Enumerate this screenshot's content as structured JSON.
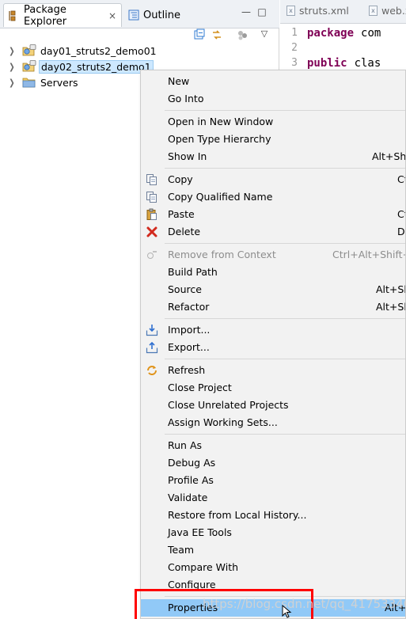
{
  "explorer": {
    "tabs": [
      {
        "label": "Package Explorer",
        "active": true
      },
      {
        "label": "Outline",
        "active": false
      }
    ],
    "close_glyph": "×",
    "minimize_glyph": "—",
    "maximize_glyph": "□",
    "view_menu_glyph": "▽",
    "tree": [
      {
        "label": "day01_struts2_demo01",
        "icon": "project-icon",
        "selected": false
      },
      {
        "label": "day02_struts2_demo1",
        "icon": "project-icon",
        "selected": true
      },
      {
        "label": "Servers",
        "icon": "folder-icon",
        "selected": false
      }
    ]
  },
  "editor": {
    "tabs": [
      {
        "label": "struts.xml",
        "icon": "xml-file-icon"
      },
      {
        "label": "web.x",
        "icon": "xml-file-icon"
      }
    ],
    "lines": [
      {
        "num": "1",
        "keyword": "package",
        "text": "com"
      },
      {
        "num": "2",
        "keyword": "",
        "text": ""
      },
      {
        "num": "3",
        "keyword": "public",
        "text": "clas"
      }
    ]
  },
  "context_menu": {
    "items": [
      {
        "label": "New",
        "shortcut": "",
        "icon": "",
        "disabled": false
      },
      {
        "label": "Go Into",
        "shortcut": "",
        "icon": "",
        "disabled": false
      },
      {
        "label": "Open in New Window",
        "shortcut": "",
        "icon": "",
        "disabled": false
      },
      {
        "label": "Open Type Hierarchy",
        "shortcut": "",
        "icon": "",
        "disabled": false
      },
      {
        "label": "Show In",
        "shortcut": "Alt+Shift",
        "icon": "",
        "disabled": false
      },
      {
        "label": "Copy",
        "shortcut": "Ct",
        "icon": "copy-icon",
        "disabled": false
      },
      {
        "label": "Copy Qualified Name",
        "shortcut": "",
        "icon": "copy-qualified-name-icon",
        "disabled": false
      },
      {
        "label": "Paste",
        "shortcut": "Ct",
        "icon": "paste-icon",
        "disabled": false
      },
      {
        "label": "Delete",
        "shortcut": "De",
        "icon": "delete-icon",
        "disabled": false
      },
      {
        "label": "Remove from Context",
        "shortcut": "Ctrl+Alt+Shift+D",
        "icon": "remove-context-icon",
        "disabled": true
      },
      {
        "label": "Build Path",
        "shortcut": "",
        "icon": "",
        "disabled": false
      },
      {
        "label": "Source",
        "shortcut": "Alt+Sh",
        "icon": "",
        "disabled": false
      },
      {
        "label": "Refactor",
        "shortcut": "Alt+Sh",
        "icon": "",
        "disabled": false
      },
      {
        "label": "Import...",
        "shortcut": "",
        "icon": "import-icon",
        "disabled": false
      },
      {
        "label": "Export...",
        "shortcut": "",
        "icon": "export-icon",
        "disabled": false
      },
      {
        "label": "Refresh",
        "shortcut": "",
        "icon": "refresh-icon",
        "disabled": false
      },
      {
        "label": "Close Project",
        "shortcut": "",
        "icon": "",
        "disabled": false
      },
      {
        "label": "Close Unrelated Projects",
        "shortcut": "",
        "icon": "",
        "disabled": false
      },
      {
        "label": "Assign Working Sets...",
        "shortcut": "",
        "icon": "",
        "disabled": false
      },
      {
        "label": "Run As",
        "shortcut": "",
        "icon": "",
        "disabled": false
      },
      {
        "label": "Debug As",
        "shortcut": "",
        "icon": "",
        "disabled": false
      },
      {
        "label": "Profile As",
        "shortcut": "",
        "icon": "",
        "disabled": false
      },
      {
        "label": "Validate",
        "shortcut": "",
        "icon": "",
        "disabled": false
      },
      {
        "label": "Restore from Local History...",
        "shortcut": "",
        "icon": "",
        "disabled": false
      },
      {
        "label": "Java EE Tools",
        "shortcut": "",
        "icon": "",
        "disabled": false
      },
      {
        "label": "Team",
        "shortcut": "",
        "icon": "",
        "disabled": false
      },
      {
        "label": "Compare With",
        "shortcut": "",
        "icon": "",
        "disabled": false
      },
      {
        "label": "Configure",
        "shortcut": "",
        "icon": "",
        "disabled": false
      },
      {
        "label": "Properties",
        "shortcut": "Alt+E",
        "icon": "",
        "disabled": false,
        "highlighted": true
      }
    ]
  },
  "watermark": "https://blog.csdn.net/qq_41753340",
  "colors": {
    "selection": "#cde8ff",
    "menu_highlight": "#91c9f7",
    "annotation_box": "#ff0000",
    "keyword": "#7f0055"
  }
}
